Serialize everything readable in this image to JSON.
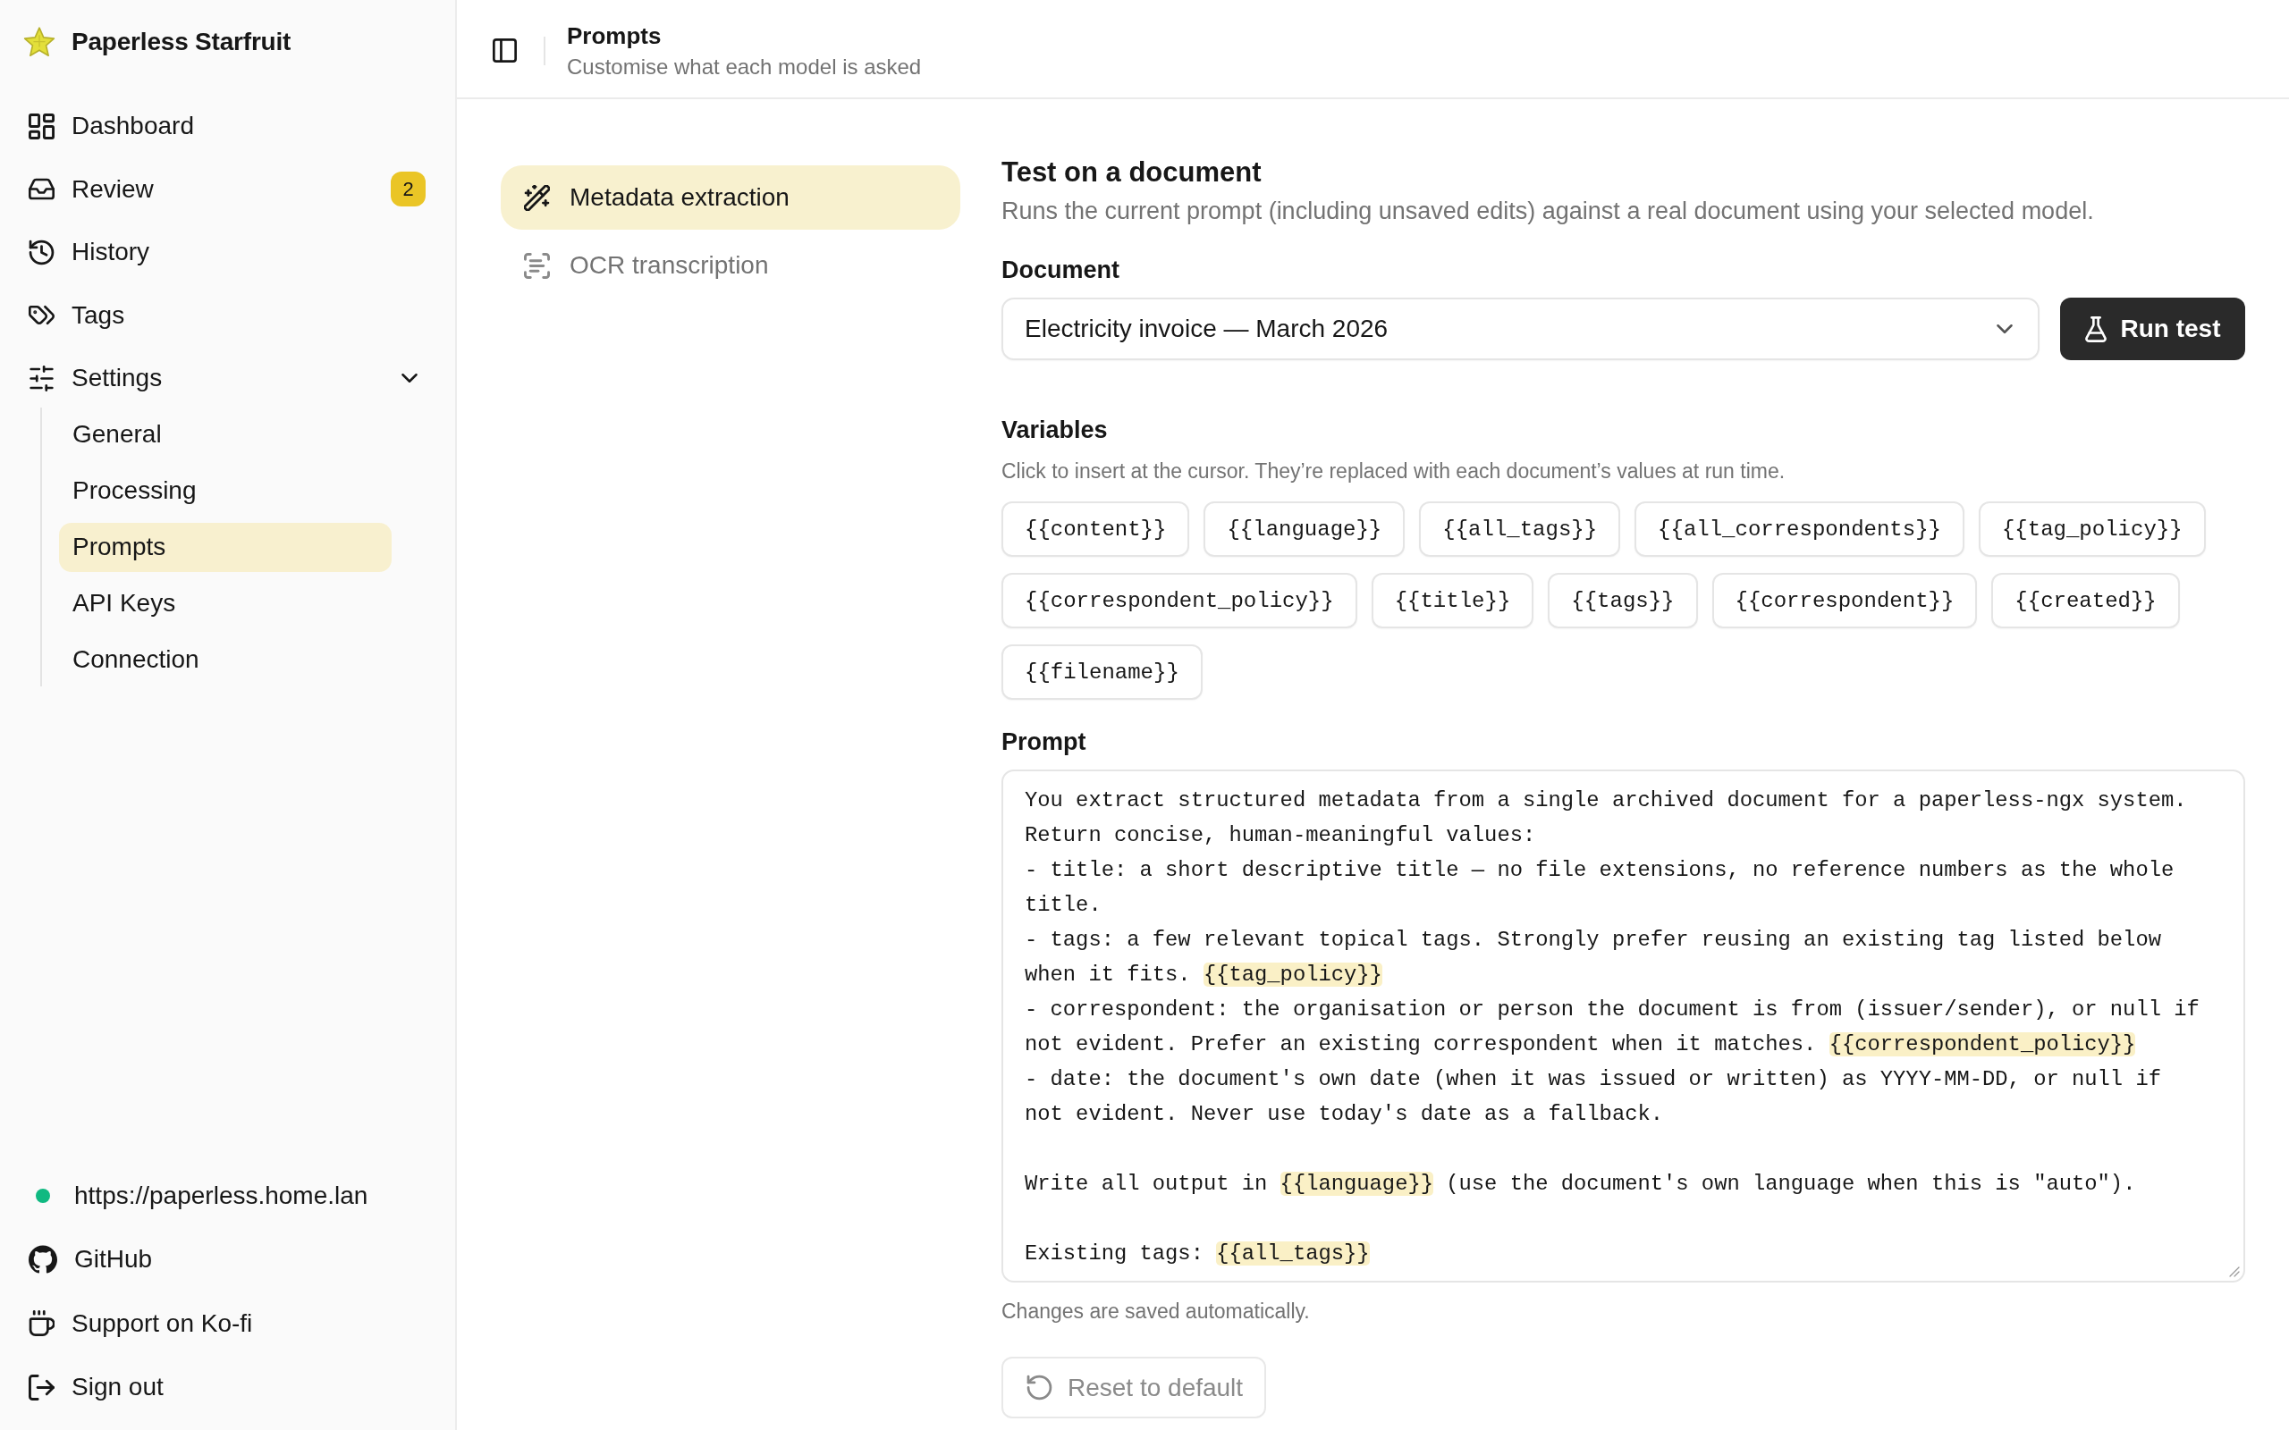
{
  "sidebar": {
    "brand": "Paperless Starfruit",
    "items": [
      {
        "label": "Dashboard",
        "selected": false
      },
      {
        "label": "Review",
        "selected": false,
        "badge": "2"
      },
      {
        "label": "History",
        "selected": false
      },
      {
        "label": "Tags",
        "selected": false
      },
      {
        "label": "Settings",
        "selected": false,
        "expanded": true,
        "children": [
          {
            "label": "General",
            "selected": false
          },
          {
            "label": "Processing",
            "selected": false
          },
          {
            "label": "Prompts",
            "selected": true
          },
          {
            "label": "API Keys",
            "selected": false
          },
          {
            "label": "Connection",
            "selected": false
          }
        ]
      }
    ],
    "footer": [
      {
        "kind": "status",
        "label": "https://paperless.home.lan",
        "color": "#10b981"
      },
      {
        "kind": "link",
        "label": "GitHub"
      },
      {
        "kind": "link",
        "label": "Support on Ko-fi"
      },
      {
        "kind": "link",
        "label": "Sign out"
      }
    ]
  },
  "header": {
    "title": "Prompts",
    "subtitle": "Customise what each model is asked"
  },
  "prompt_types": [
    {
      "label": "Metadata extraction",
      "selected": true
    },
    {
      "label": "OCR transcription",
      "selected": false
    }
  ],
  "test": {
    "title": "Test on a document",
    "description": "Runs the current prompt (including unsaved edits) against a real document using your selected model.",
    "document_label": "Document",
    "document_value": "Electricity invoice — March 2026",
    "run_button": "Run test"
  },
  "variables": {
    "label": "Variables",
    "hint": "Click to insert at the cursor. They’re replaced with each document’s values at run time.",
    "chips": [
      "{{content}}",
      "{{language}}",
      "{{all_tags}}",
      "{{all_correspondents}}",
      "{{tag_policy}}",
      "{{correspondent_policy}}",
      "{{title}}",
      "{{tags}}",
      "{{correspondent}}",
      "{{created}}",
      "{{filename}}"
    ]
  },
  "prompt": {
    "label": "Prompt",
    "paragraphs": [
      [
        [
          {
            "kind": "text",
            "text": "You extract structured metadata from a single archived document for a paperless-ngx system."
          }
        ],
        [
          {
            "kind": "text",
            "text": "Return concise, human-meaningful values:"
          }
        ],
        [
          {
            "kind": "text",
            "text": "- title: a short descriptive title — no file extensions, no reference numbers as the whole"
          }
        ],
        [
          {
            "kind": "text",
            "text": "title."
          }
        ],
        [
          {
            "kind": "text",
            "text": "- tags: a few relevant topical tags. Strongly prefer reusing an existing tag listed below"
          }
        ],
        [
          {
            "kind": "text",
            "text": "when it fits. "
          },
          {
            "kind": "variable",
            "text": "{{tag_policy}}"
          }
        ],
        [
          {
            "kind": "text",
            "text": "- correspondent: the organisation or person the document is from (issuer/sender), or null if"
          }
        ],
        [
          {
            "kind": "text",
            "text": "not evident. Prefer an existing correspondent when it matches. "
          },
          {
            "kind": "variable",
            "text": "{{correspondent_policy}}"
          }
        ],
        [
          {
            "kind": "text",
            "text": "- date: the document's own date (when it was issued or written) as YYYY-MM-DD, or null if"
          }
        ],
        [
          {
            "kind": "text",
            "text": "not evident. Never use today's date as a fallback."
          }
        ]
      ],
      [
        [
          {
            "kind": "text",
            "text": "Write all output in "
          },
          {
            "kind": "variable",
            "text": "{{language}}"
          },
          {
            "kind": "text",
            "text": " (use the document's own language when this is \"auto\")."
          }
        ]
      ],
      [
        [
          {
            "kind": "text",
            "text": "Existing tags: "
          },
          {
            "kind": "variable",
            "text": "{{all_tags}}"
          }
        ]
      ]
    ],
    "note": "Changes are saved automatically.",
    "reset_button": {
      "label": "Reset to default",
      "disabled": true
    }
  }
}
